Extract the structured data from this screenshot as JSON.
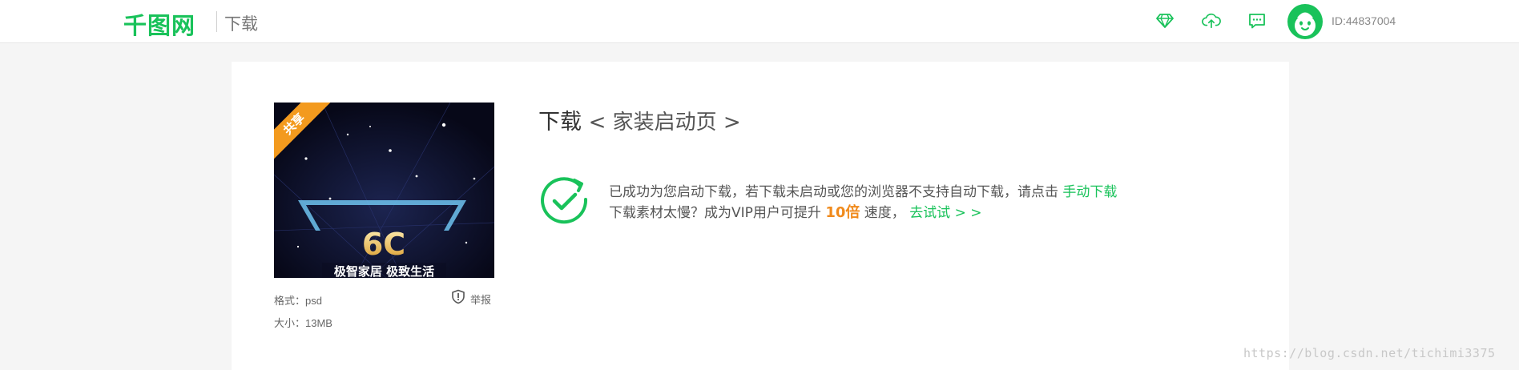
{
  "header": {
    "logo_text": "千图网",
    "page_tag": "下载",
    "icons": [
      "diamond-icon",
      "cloud-upload-icon",
      "message-icon"
    ],
    "user_id": "ID:44837004"
  },
  "preview": {
    "ribbon": "共享",
    "image_text_big": "6C",
    "image_text_sub": "极智家居 极致生活",
    "format_label": "格式：psd",
    "size_label": "大小：13MB",
    "report_label": "举报"
  },
  "main": {
    "title": "下载",
    "subtitle": "< 家装启动页 >",
    "line1_text": "已成功为您启动下载，若下载未启动或您的浏览器不支持自动下载，请点击",
    "manual_link": "手动下载",
    "line2_prefix": "下载素材太慢？成为VIP用户可提升",
    "line2_highlight": "10倍",
    "line2_suffix": "速度，",
    "try_link": "去试试 > >"
  },
  "watermark": "https://blog.csdn.net/tichimi3375",
  "colors": {
    "brand_green": "#19c25a",
    "highlight_orange": "#f08a1c",
    "ribbon_orange": "#f39a1e"
  }
}
